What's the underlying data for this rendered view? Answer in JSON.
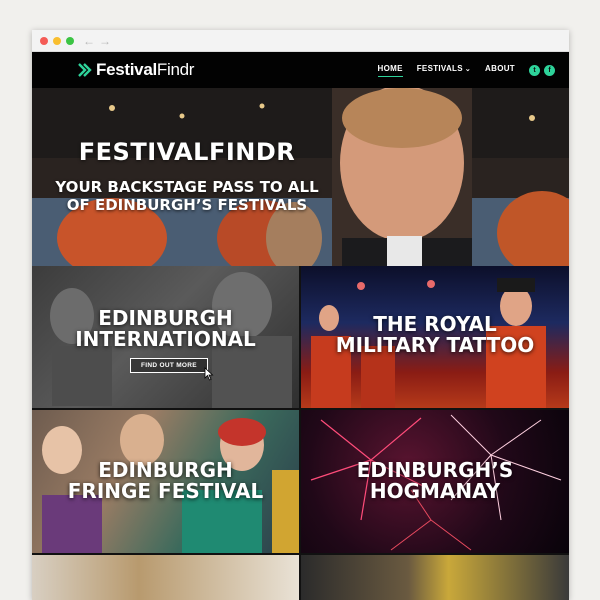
{
  "brand": {
    "logo_part1": "Festival",
    "logo_part2": "Findr",
    "accent_color": "#2ed39a"
  },
  "nav": {
    "items": [
      {
        "label": "HOME",
        "active": true
      },
      {
        "label": "FESTIVALS",
        "has_dropdown": true
      },
      {
        "label": "ABOUT"
      }
    ],
    "social": [
      {
        "icon": "twitter-icon",
        "glyph": "t"
      },
      {
        "icon": "facebook-icon",
        "glyph": "f"
      }
    ]
  },
  "hero": {
    "title": "FESTIVALFINDR",
    "subtitle_line1": "YOUR BACKSTAGE PASS TO ALL",
    "subtitle_line2": "OF EDINBURGH’S FESTIVALS"
  },
  "tiles": [
    {
      "line1": "EDINBURGH",
      "line2": "INTERNATIONAL",
      "button": "FIND OUT MORE"
    },
    {
      "line1": "THE ROYAL",
      "line2": "MILITARY TATTOO"
    },
    {
      "line1": "EDINBURGH",
      "line2": "FRINGE FESTIVAL"
    },
    {
      "line1": "EDINBURGH’S",
      "line2": "HOGMANAY"
    }
  ]
}
